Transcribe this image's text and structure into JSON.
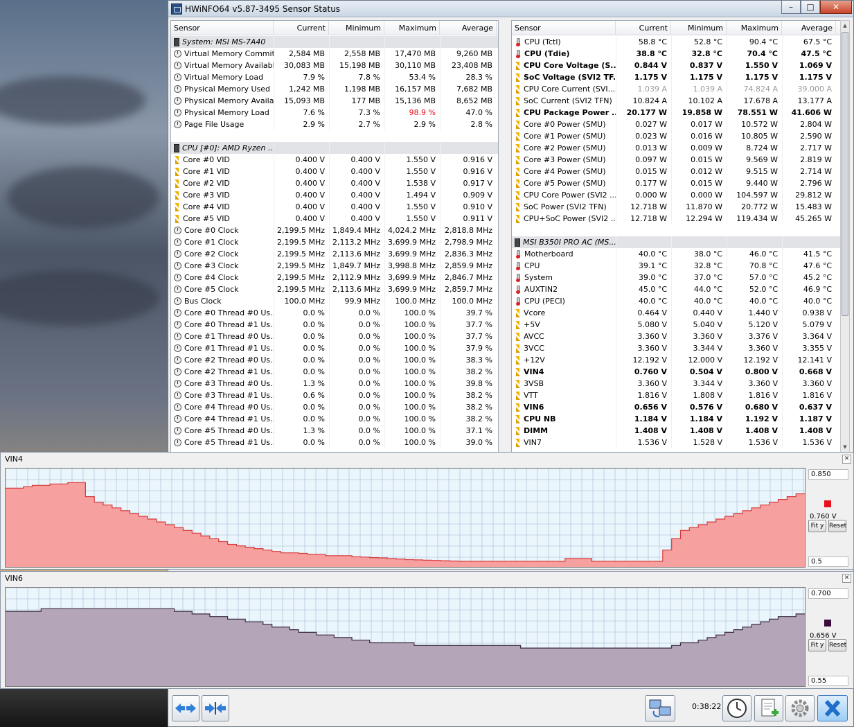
{
  "window": {
    "title": "HWiNFO64 v5.87-3495 Sensor Status",
    "min_glyph": "–",
    "max_glyph": "□",
    "close_glyph": "✕"
  },
  "left": {
    "headers": [
      "Sensor",
      "Current",
      "Minimum",
      "Maximum",
      "Average"
    ],
    "rows": [
      {
        "type": "group",
        "icon": "chip",
        "name": "System: MSI MS-7A40"
      },
      {
        "icon": "clock",
        "name": "Virtual Memory Commited",
        "v": [
          "2,584 MB",
          "2,558 MB",
          "17,470 MB",
          "9,260 MB"
        ]
      },
      {
        "icon": "clock",
        "name": "Virtual Memory Available",
        "v": [
          "30,083 MB",
          "15,198 MB",
          "30,110 MB",
          "23,408 MB"
        ]
      },
      {
        "icon": "clock",
        "name": "Virtual Memory Load",
        "v": [
          "7.9 %",
          "7.8 %",
          "53.4 %",
          "28.3 %"
        ]
      },
      {
        "icon": "clock",
        "name": "Physical Memory Used",
        "v": [
          "1,242 MB",
          "1,198 MB",
          "16,157 MB",
          "7,682 MB"
        ]
      },
      {
        "icon": "clock",
        "name": "Physical Memory Availa...",
        "v": [
          "15,093 MB",
          "177 MB",
          "15,136 MB",
          "8,652 MB"
        ]
      },
      {
        "icon": "clock",
        "name": "Physical Memory Load",
        "v": [
          "7.6 %",
          "7.3 %",
          "98.9 %",
          "47.0 %"
        ],
        "red": 2
      },
      {
        "icon": "clock",
        "name": "Page File Usage",
        "v": [
          "2.9 %",
          "2.7 %",
          "2.9 %",
          "2.8 %"
        ]
      },
      {
        "type": "blank"
      },
      {
        "type": "group",
        "icon": "chip",
        "name": "CPU [#0]: AMD Ryzen ..."
      },
      {
        "icon": "bolt",
        "name": "Core #0 VID",
        "v": [
          "0.400 V",
          "0.400 V",
          "1.550 V",
          "0.916 V"
        ]
      },
      {
        "icon": "bolt",
        "name": "Core #1 VID",
        "v": [
          "0.400 V",
          "0.400 V",
          "1.550 V",
          "0.916 V"
        ]
      },
      {
        "icon": "bolt",
        "name": "Core #2 VID",
        "v": [
          "0.400 V",
          "0.400 V",
          "1.538 V",
          "0.917 V"
        ]
      },
      {
        "icon": "bolt",
        "name": "Core #3 VID",
        "v": [
          "0.400 V",
          "0.400 V",
          "1.494 V",
          "0.909 V"
        ]
      },
      {
        "icon": "bolt",
        "name": "Core #4 VID",
        "v": [
          "0.400 V",
          "0.400 V",
          "1.550 V",
          "0.910 V"
        ]
      },
      {
        "icon": "bolt",
        "name": "Core #5 VID",
        "v": [
          "0.400 V",
          "0.400 V",
          "1.550 V",
          "0.911 V"
        ]
      },
      {
        "icon": "clock",
        "name": "Core #0 Clock",
        "v": [
          "2,199.5 MHz",
          "1,849.4 MHz",
          "4,024.2 MHz",
          "2,818.8 MHz"
        ]
      },
      {
        "icon": "clock",
        "name": "Core #1 Clock",
        "v": [
          "2,199.5 MHz",
          "2,113.2 MHz",
          "3,699.9 MHz",
          "2,798.9 MHz"
        ]
      },
      {
        "icon": "clock",
        "name": "Core #2 Clock",
        "v": [
          "2,199.5 MHz",
          "2,113.6 MHz",
          "3,699.9 MHz",
          "2,836.3 MHz"
        ]
      },
      {
        "icon": "clock",
        "name": "Core #3 Clock",
        "v": [
          "2,199.5 MHz",
          "1,849.7 MHz",
          "3,998.8 MHz",
          "2,859.9 MHz"
        ]
      },
      {
        "icon": "clock",
        "name": "Core #4 Clock",
        "v": [
          "2,199.5 MHz",
          "2,112.9 MHz",
          "3,699.9 MHz",
          "2,846.7 MHz"
        ]
      },
      {
        "icon": "clock",
        "name": "Core #5 Clock",
        "v": [
          "2,199.5 MHz",
          "2,113.6 MHz",
          "3,699.9 MHz",
          "2,859.7 MHz"
        ]
      },
      {
        "icon": "clock",
        "name": "Bus Clock",
        "v": [
          "100.0 MHz",
          "99.9 MHz",
          "100.0 MHz",
          "100.0 MHz"
        ]
      },
      {
        "icon": "clock",
        "name": "Core #0 Thread #0 Us...",
        "v": [
          "0.0 %",
          "0.0 %",
          "100.0 %",
          "39.7 %"
        ]
      },
      {
        "icon": "clock",
        "name": "Core #0 Thread #1 Us...",
        "v": [
          "0.0 %",
          "0.0 %",
          "100.0 %",
          "37.7 %"
        ]
      },
      {
        "icon": "clock",
        "name": "Core #1 Thread #0 Us...",
        "v": [
          "0.0 %",
          "0.0 %",
          "100.0 %",
          "37.7 %"
        ]
      },
      {
        "icon": "clock",
        "name": "Core #1 Thread #1 Us...",
        "v": [
          "0.0 %",
          "0.0 %",
          "100.0 %",
          "37.9 %"
        ]
      },
      {
        "icon": "clock",
        "name": "Core #2 Thread #0 Us...",
        "v": [
          "0.0 %",
          "0.0 %",
          "100.0 %",
          "38.3 %"
        ]
      },
      {
        "icon": "clock",
        "name": "Core #2 Thread #1 Us...",
        "v": [
          "0.0 %",
          "0.0 %",
          "100.0 %",
          "38.2 %"
        ]
      },
      {
        "icon": "clock",
        "name": "Core #3 Thread #0 Us...",
        "v": [
          "1.3 %",
          "0.0 %",
          "100.0 %",
          "39.8 %"
        ]
      },
      {
        "icon": "clock",
        "name": "Core #3 Thread #1 Us...",
        "v": [
          "0.6 %",
          "0.0 %",
          "100.0 %",
          "38.2 %"
        ]
      },
      {
        "icon": "clock",
        "name": "Core #4 Thread #0 Us...",
        "v": [
          "0.0 %",
          "0.0 %",
          "100.0 %",
          "38.2 %"
        ]
      },
      {
        "icon": "clock",
        "name": "Core #4 Thread #1 Us...",
        "v": [
          "0.0 %",
          "0.0 %",
          "100.0 %",
          "38.2 %"
        ]
      },
      {
        "icon": "clock",
        "name": "Core #5 Thread #0 Us...",
        "v": [
          "1.3 %",
          "0.0 %",
          "100.0 %",
          "37.1 %"
        ]
      },
      {
        "icon": "clock",
        "name": "Core #5 Thread #1 Us...",
        "v": [
          "0.0 %",
          "0.0 %",
          "100.0 %",
          "39.0 %"
        ]
      }
    ]
  },
  "right": {
    "headers": [
      "Sensor",
      "Current",
      "Minimum",
      "Maximum",
      "Average"
    ],
    "rows": [
      {
        "icon": "therm",
        "name": "CPU (Tctl)",
        "v": [
          "58.8 °C",
          "52.8 °C",
          "90.4 °C",
          "67.5 °C"
        ]
      },
      {
        "icon": "therm",
        "name": "CPU (Tdie)",
        "v": [
          "38.8 °C",
          "32.8 °C",
          "70.4 °C",
          "47.5 °C"
        ],
        "bold": true
      },
      {
        "icon": "bolt",
        "name": "CPU Core Voltage (S...",
        "v": [
          "0.844 V",
          "0.837 V",
          "1.550 V",
          "1.069 V"
        ],
        "bold": true
      },
      {
        "icon": "bolt",
        "name": "SoC Voltage (SVI2 TF...",
        "v": [
          "1.175 V",
          "1.175 V",
          "1.175 V",
          "1.175 V"
        ],
        "bold": true
      },
      {
        "icon": "bolt",
        "name": "CPU Core Current (SVI...",
        "v": [
          "1.039 A",
          "1.039 A",
          "74.824 A",
          "39.000 A"
        ],
        "dim": true
      },
      {
        "icon": "bolt",
        "name": "SoC Current (SVI2 TFN)",
        "v": [
          "10.824 A",
          "10.102 A",
          "17.678 A",
          "13.177 A"
        ]
      },
      {
        "icon": "bolt",
        "name": "CPU Package Power ...",
        "v": [
          "20.177 W",
          "19.858 W",
          "78.551 W",
          "41.606 W"
        ],
        "bold": true
      },
      {
        "icon": "bolt",
        "name": "Core #0 Power (SMU)",
        "v": [
          "0.027 W",
          "0.017 W",
          "10.572 W",
          "2.804 W"
        ]
      },
      {
        "icon": "bolt",
        "name": "Core #1 Power (SMU)",
        "v": [
          "0.023 W",
          "0.016 W",
          "10.805 W",
          "2.590 W"
        ]
      },
      {
        "icon": "bolt",
        "name": "Core #2 Power (SMU)",
        "v": [
          "0.013 W",
          "0.009 W",
          "8.724 W",
          "2.717 W"
        ]
      },
      {
        "icon": "bolt",
        "name": "Core #3 Power (SMU)",
        "v": [
          "0.097 W",
          "0.015 W",
          "9.569 W",
          "2.819 W"
        ]
      },
      {
        "icon": "bolt",
        "name": "Core #4 Power (SMU)",
        "v": [
          "0.015 W",
          "0.012 W",
          "9.515 W",
          "2.714 W"
        ]
      },
      {
        "icon": "bolt",
        "name": "Core #5 Power (SMU)",
        "v": [
          "0.177 W",
          "0.015 W",
          "9.440 W",
          "2.796 W"
        ]
      },
      {
        "icon": "bolt",
        "name": "CPU Core Power (SVI2 ...",
        "v": [
          "0.000 W",
          "0.000 W",
          "104.597 W",
          "29.812 W"
        ]
      },
      {
        "icon": "bolt",
        "name": "SoC Power (SVI2 TFN)",
        "v": [
          "12.718 W",
          "11.870 W",
          "20.772 W",
          "15.483 W"
        ]
      },
      {
        "icon": "bolt",
        "name": "CPU+SoC Power (SVI2 ...",
        "v": [
          "12.718 W",
          "12.294 W",
          "119.434 W",
          "45.265 W"
        ]
      },
      {
        "type": "blank"
      },
      {
        "type": "group",
        "icon": "chip",
        "name": "MSI B350I PRO AC (MS..."
      },
      {
        "icon": "therm",
        "name": "Motherboard",
        "v": [
          "40.0 °C",
          "38.0 °C",
          "46.0 °C",
          "41.5 °C"
        ]
      },
      {
        "icon": "therm",
        "name": "CPU",
        "v": [
          "39.1 °C",
          "32.8 °C",
          "70.8 °C",
          "47.6 °C"
        ]
      },
      {
        "icon": "therm",
        "name": "System",
        "v": [
          "39.0 °C",
          "37.0 °C",
          "57.0 °C",
          "45.2 °C"
        ]
      },
      {
        "icon": "therm",
        "name": "AUXTIN2",
        "v": [
          "45.0 °C",
          "44.0 °C",
          "52.0 °C",
          "46.9 °C"
        ]
      },
      {
        "icon": "therm",
        "name": "CPU (PECI)",
        "v": [
          "40.0 °C",
          "40.0 °C",
          "40.0 °C",
          "40.0 °C"
        ]
      },
      {
        "icon": "bolt",
        "name": "Vcore",
        "v": [
          "0.464 V",
          "0.440 V",
          "1.440 V",
          "0.938 V"
        ]
      },
      {
        "icon": "bolt",
        "name": "+5V",
        "v": [
          "5.080 V",
          "5.040 V",
          "5.120 V",
          "5.079 V"
        ]
      },
      {
        "icon": "bolt",
        "name": "AVCC",
        "v": [
          "3.360 V",
          "3.360 V",
          "3.376 V",
          "3.364 V"
        ]
      },
      {
        "icon": "bolt",
        "name": "3VCC",
        "v": [
          "3.360 V",
          "3.344 V",
          "3.360 V",
          "3.355 V"
        ]
      },
      {
        "icon": "bolt",
        "name": "+12V",
        "v": [
          "12.192 V",
          "12.000 V",
          "12.192 V",
          "12.141 V"
        ]
      },
      {
        "icon": "bolt",
        "name": "VIN4",
        "v": [
          "0.760 V",
          "0.504 V",
          "0.800 V",
          "0.668 V"
        ],
        "bold": true
      },
      {
        "icon": "bolt",
        "name": "3VSB",
        "v": [
          "3.360 V",
          "3.344 V",
          "3.360 V",
          "3.360 V"
        ]
      },
      {
        "icon": "bolt",
        "name": "VTT",
        "v": [
          "1.816 V",
          "1.808 V",
          "1.816 V",
          "1.816 V"
        ]
      },
      {
        "icon": "bolt",
        "name": "VIN6",
        "v": [
          "0.656 V",
          "0.576 V",
          "0.680 V",
          "0.637 V"
        ],
        "bold": true
      },
      {
        "icon": "bolt",
        "name": "CPU NB",
        "v": [
          "1.184 V",
          "1.184 V",
          "1.192 V",
          "1.187 V"
        ],
        "bold": true
      },
      {
        "icon": "bolt",
        "name": "DIMM",
        "v": [
          "1.408 V",
          "1.408 V",
          "1.408 V",
          "1.408 V"
        ],
        "bold": true
      },
      {
        "icon": "bolt",
        "name": "VIN7",
        "v": [
          "1.536 V",
          "1.528 V",
          "1.536 V",
          "1.536 V"
        ]
      }
    ]
  },
  "graphs": [
    {
      "title": "VIN4",
      "top_value": "0.850",
      "current_value": "0.760 V",
      "bottom_value": "0.5",
      "fill": "#f7a0a0",
      "line": "#d83a3a",
      "swatch": "#e8101a",
      "ymin": 0.5,
      "ymax": 0.85,
      "values": [
        0.78,
        0.78,
        0.785,
        0.79,
        0.79,
        0.795,
        0.795,
        0.8,
        0.8,
        0.75,
        0.73,
        0.72,
        0.71,
        0.7,
        0.69,
        0.68,
        0.67,
        0.66,
        0.65,
        0.64,
        0.63,
        0.62,
        0.61,
        0.6,
        0.59,
        0.58,
        0.575,
        0.57,
        0.565,
        0.56,
        0.555,
        0.55,
        0.55,
        0.548,
        0.545,
        0.545,
        0.54,
        0.54,
        0.54,
        0.536,
        0.535,
        0.533,
        0.532,
        0.53,
        0.528,
        0.526,
        0.525,
        0.524,
        0.523,
        0.522,
        0.521,
        0.52,
        0.52,
        0.52,
        0.52,
        0.52,
        0.52,
        0.52,
        0.52,
        0.52,
        0.52,
        0.52,
        0.52,
        0.53,
        0.53,
        0.53,
        0.52,
        0.52,
        0.52,
        0.52,
        0.52,
        0.52,
        0.52,
        0.52,
        0.56,
        0.6,
        0.63,
        0.64,
        0.65,
        0.66,
        0.67,
        0.68,
        0.69,
        0.7,
        0.71,
        0.72,
        0.73,
        0.74,
        0.75,
        0.76,
        0.76
      ]
    },
    {
      "title": "VIN6",
      "top_value": "0.700",
      "current_value": "0.656 V",
      "bottom_value": "0.55",
      "fill": "#b4a6b8",
      "line": "#3a2a3e",
      "swatch": "#3a0a3a",
      "ymin": 0.55,
      "ymax": 0.7,
      "values": [
        0.664,
        0.664,
        0.664,
        0.664,
        0.668,
        0.668,
        0.668,
        0.668,
        0.668,
        0.668,
        0.668,
        0.668,
        0.668,
        0.668,
        0.668,
        0.668,
        0.668,
        0.668,
        0.668,
        0.664,
        0.664,
        0.66,
        0.66,
        0.656,
        0.656,
        0.652,
        0.652,
        0.648,
        0.648,
        0.644,
        0.64,
        0.64,
        0.636,
        0.632,
        0.632,
        0.628,
        0.628,
        0.624,
        0.624,
        0.62,
        0.62,
        0.616,
        0.616,
        0.616,
        0.616,
        0.616,
        0.612,
        0.612,
        0.612,
        0.612,
        0.612,
        0.612,
        0.612,
        0.612,
        0.612,
        0.612,
        0.612,
        0.612,
        0.608,
        0.608,
        0.608,
        0.608,
        0.608,
        0.608,
        0.608,
        0.608,
        0.608,
        0.608,
        0.608,
        0.608,
        0.608,
        0.608,
        0.608,
        0.608,
        0.608,
        0.612,
        0.616,
        0.616,
        0.62,
        0.624,
        0.628,
        0.632,
        0.636,
        0.64,
        0.644,
        0.648,
        0.652,
        0.656,
        0.656,
        0.66,
        0.66
      ]
    }
  ],
  "buttons": {
    "fit_y": "Fit y",
    "reset": "Reset"
  },
  "footer": {
    "timer": "0:38:22"
  }
}
